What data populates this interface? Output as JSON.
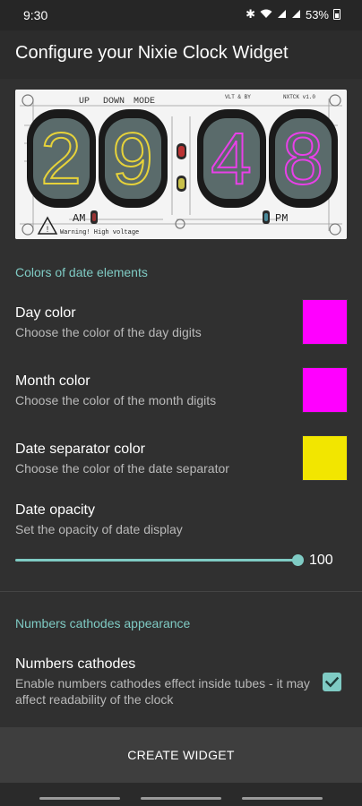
{
  "status_bar": {
    "time": "9:30",
    "battery": "53%"
  },
  "app_bar": {
    "title": "Configure your Nixie Clock Widget"
  },
  "preview": {
    "labels": [
      "UP",
      "DOWN",
      "MODE"
    ],
    "brand": "VLT & BY",
    "model": "NXTCK v1.0",
    "digits": [
      "2",
      "9",
      "4",
      "8"
    ],
    "digit_colors": [
      "#e6d23a",
      "#e6d23a",
      "#e840e8",
      "#e840e8"
    ],
    "am_label": "AM",
    "pm_label": "PM",
    "warning": "Warning! High voltage"
  },
  "date_section": {
    "title": "Colors of date elements",
    "day_color": {
      "title": "Day color",
      "summary": "Choose the color of the day digits",
      "color": "#ff00ff"
    },
    "month_color": {
      "title": "Month color",
      "summary": "Choose the color of the month digits",
      "color": "#ff00ff"
    },
    "separator_color": {
      "title": "Date separator color",
      "summary": "Choose the color of the date separator",
      "color": "#f2e600"
    },
    "opacity": {
      "title": "Date opacity",
      "summary": "Set the opacity of date display",
      "value": "100",
      "fraction": 1.0
    }
  },
  "cathodes_section": {
    "title": "Numbers cathodes appearance",
    "cathodes": {
      "title": "Numbers cathodes",
      "summary": "Enable numbers cathodes effect inside tubes - it may affect readability of the clock",
      "checked": true
    }
  },
  "create_button": {
    "label": "CREATE WIDGET"
  },
  "colors": {
    "accent": "#7fcbc4"
  }
}
